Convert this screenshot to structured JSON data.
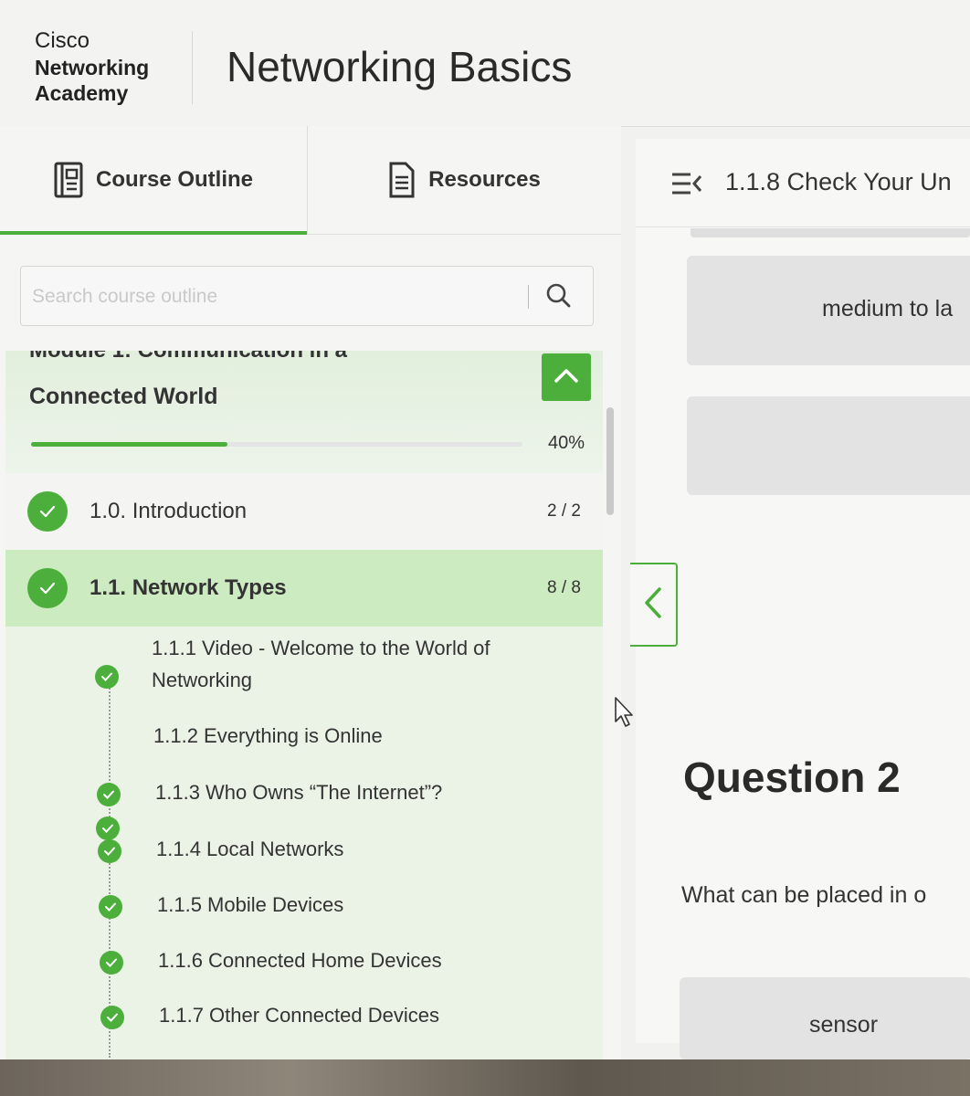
{
  "brand": {
    "line1": "Cisco",
    "line2": "Networking",
    "line3": "Academy"
  },
  "app_title": "Networking Basics",
  "tabs": [
    {
      "label": "Course Outline",
      "icon": "outline-book-icon",
      "active": true
    },
    {
      "label": "Resources",
      "icon": "document-icon",
      "active": false
    }
  ],
  "search": {
    "placeholder": "Search course outline",
    "value": ""
  },
  "module": {
    "partial_title": "Module 1: Communication in a",
    "title": "Connected World",
    "progress_percent": 40,
    "progress_label": "40%"
  },
  "sections": [
    {
      "label": "1.0. Introduction",
      "count": "2 / 2",
      "complete": true,
      "selected": false
    },
    {
      "label": "1.1. Network Types",
      "count": "8 / 8",
      "complete": true,
      "selected": true
    }
  ],
  "topics": [
    {
      "line1": "1.1.1 Video - Welcome to the World of",
      "line2": "Networking",
      "complete": true
    },
    {
      "line1": "1.1.2 Everything is Online",
      "complete": true
    },
    {
      "line1": "1.1.3 Who Owns “The Internet”?",
      "complete": true
    },
    {
      "line1": "1.1.4 Local Networks",
      "complete": true
    },
    {
      "line1": "1.1.5 Mobile Devices",
      "complete": true
    },
    {
      "line1": "1.1.6 Connected Home Devices",
      "complete": true
    },
    {
      "line1": "1.1.7 Other Connected Devices",
      "complete": true
    }
  ],
  "content": {
    "topic_title": "1.1.8 Check Your Un",
    "answer_option_1": "medium to la",
    "question_title": "Question 2",
    "question_text": "What can be placed in o",
    "answer_option_3": "sensor"
  },
  "colors": {
    "accent": "#4caf3c",
    "selected_row": "#ccebc0",
    "module_bg": "#e2efdd"
  }
}
